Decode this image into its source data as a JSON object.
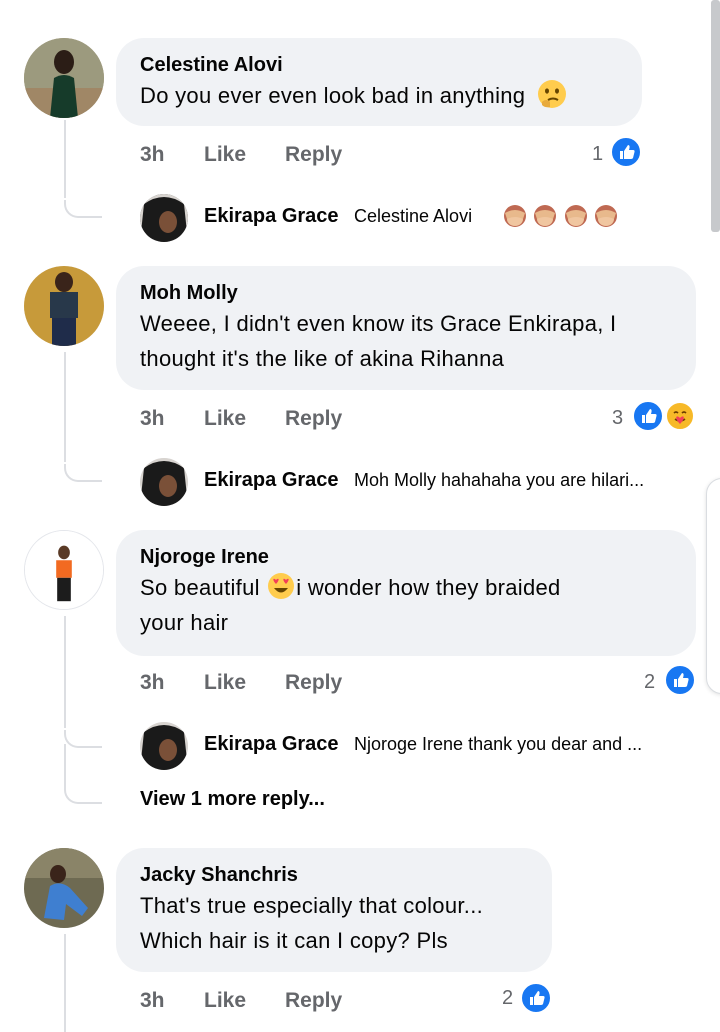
{
  "comments": [
    {
      "name": "Celestine Alovi",
      "text": "Do you ever even look bad in anything",
      "time": "3h",
      "like_label": "Like",
      "reply_label": "Reply",
      "reaction_count": "1",
      "reply": {
        "name": "Ekirapa Grace",
        "text": "Celestine Alovi"
      }
    },
    {
      "name": "Moh Molly",
      "text_line1": "Weeee, I didn't even know its Grace Enkirapa, I",
      "text_line2": "thought it's the like of akina Rihanna",
      "time": "3h",
      "like_label": "Like",
      "reply_label": "Reply",
      "reaction_count": "3",
      "reply": {
        "name": "Ekirapa Grace",
        "text": "Moh Molly hahahaha you are hilari..."
      }
    },
    {
      "name": "Njoroge Irene",
      "text_line1a": "So beautiful",
      "text_line1b": "i wonder how they braided",
      "text_line2": "your hair",
      "time": "3h",
      "like_label": "Like",
      "reply_label": "Reply",
      "reaction_count": "2",
      "reply": {
        "name": "Ekirapa Grace",
        "text": "Njoroge Irene thank you dear and ..."
      },
      "more_replies": "View 1 more reply..."
    },
    {
      "name": "Jacky Shanchris",
      "text_line1": "That's true especially that colour...",
      "text_line2": "Which hair is it can I copy? Pls",
      "time": "3h",
      "like_label": "Like",
      "reply_label": "Reply",
      "reaction_count": "2"
    }
  ],
  "colors": {
    "accent": "#1877f2",
    "bubble": "#f0f2f5",
    "meta": "#65676b"
  },
  "icons": [
    "thinking-face-emoji",
    "see-no-evil-monkey-emoji",
    "like-reaction-icon",
    "care-reaction-icon",
    "heart-eyes-emoji"
  ]
}
